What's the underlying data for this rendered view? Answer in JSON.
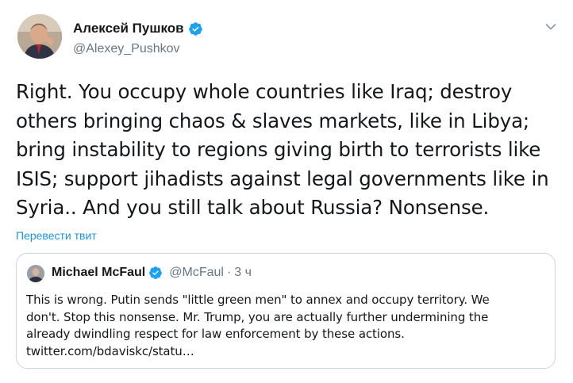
{
  "tweet": {
    "author": {
      "name": "Алексей Пушков",
      "handle": "@Alexey_Pushkov",
      "verified": true
    },
    "text_lines": [
      "Right. You occupy whole countries like Iraq; destroy",
      "others bringing chaos & slaves markets, like in Libya;",
      "bring instability to regions giving birth to terrorists like",
      "ISIS; support jihadists against legal governments like in",
      "Syria.. And you still talk about Russia? Nonsense."
    ],
    "translate_label": "Перевести твит",
    "menu_icon": "chevron-down-icon"
  },
  "quoted_tweet": {
    "author": {
      "name": "Michael McFaul",
      "handle": "@McFaul",
      "separator": "·",
      "time": "3 ч",
      "verified": true
    },
    "text_lines": [
      "This is wrong. Putin sends \"little green men\" to annex and occupy territory. We",
      "don't.  Stop this nonsense. Mr. Trump, you are actually further undermining the",
      "already dwindling respect for law enforcement by these actions.",
      "twitter.com/bdaviskc/statu…"
    ]
  },
  "colors": {
    "verified": "#1da1f2",
    "link": "#1b95e0",
    "secondary_text": "#657786",
    "border": "#ccd6dd"
  }
}
